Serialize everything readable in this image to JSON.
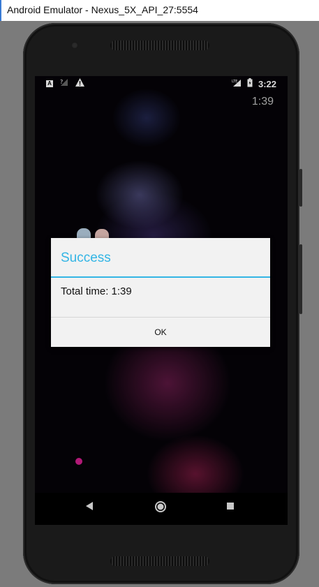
{
  "window": {
    "title": "Android Emulator - Nexus_5X_API_27:5554"
  },
  "statusbar": {
    "time": "3:22"
  },
  "game": {
    "timer": "1:39"
  },
  "dialog": {
    "title": "Success",
    "message": "Total time: 1:39",
    "ok_label": "OK"
  },
  "colors": {
    "accent": "#33b5e5",
    "dot": "#d21e8c"
  }
}
